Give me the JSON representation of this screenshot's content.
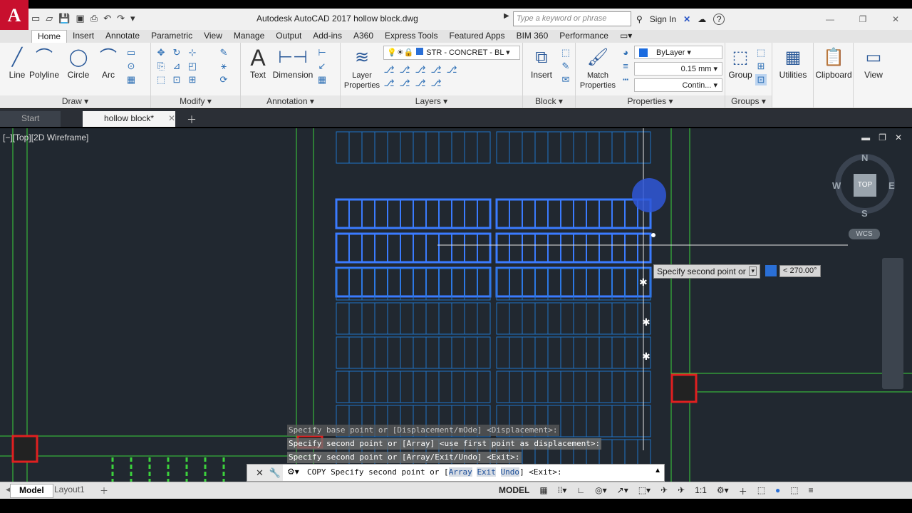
{
  "titlebar": {
    "app_icon": "A",
    "title": "Autodesk AutoCAD 2017    hollow block.dwg",
    "search_placeholder": "Type a keyword or phrase",
    "sign_in": "Sign In",
    "help": "?"
  },
  "ribbon_tabs": [
    "Home",
    "Insert",
    "Annotate",
    "Parametric",
    "View",
    "Manage",
    "Output",
    "Add-ins",
    "A360",
    "Express Tools",
    "Featured Apps",
    "BIM 360",
    "Performance"
  ],
  "draw": {
    "line": "Line",
    "polyline": "Polyline",
    "circle": "Circle",
    "arc": "Arc",
    "title": "Draw"
  },
  "modify": {
    "title": "Modify"
  },
  "annotation": {
    "text": "Text",
    "dimension": "Dimension",
    "title": "Annotation"
  },
  "layers": {
    "layer_properties": "Layer Properties",
    "current_layer": "STR - CONCRET - BL",
    "title": "Layers"
  },
  "block": {
    "insert": "Insert",
    "title": "Block"
  },
  "properties": {
    "match": "Match Properties",
    "color": "ByLayer",
    "lineweight": "0.15 mm",
    "linetype": "Contin...",
    "title": "Properties"
  },
  "groups": {
    "group": "Group",
    "title": "Groups"
  },
  "utilities": "Utilities",
  "clipboard": "Clipboard",
  "view": "View",
  "file_tabs": {
    "start": "Start",
    "active": "hollow block*"
  },
  "viewport": {
    "label": "[−][Top][2D Wireframe]"
  },
  "viewcube": {
    "n": "N",
    "s": "S",
    "e": "E",
    "w": "W",
    "top": "TOP",
    "wcs": "WCS"
  },
  "dynamic_input": {
    "prompt": "Specify second point or",
    "value": "",
    "angle": "< 270.00°"
  },
  "history": [
    "Specify base point or [Displacement/mOde] <Displacement>:",
    "Specify second point or [Array] <use first point as displacement>:",
    "Specify second point or [Array/Exit/Undo] <Exit>:"
  ],
  "command": {
    "prefix": "COPY Specify second point or [",
    "opt1": "Array",
    "opt2": "Exit",
    "opt3": "Undo",
    "suffix": "] <Exit>:"
  },
  "status": {
    "model_tab": "Model",
    "layout_tab": "Layout1",
    "model": "MODEL",
    "scale": "1:1"
  }
}
